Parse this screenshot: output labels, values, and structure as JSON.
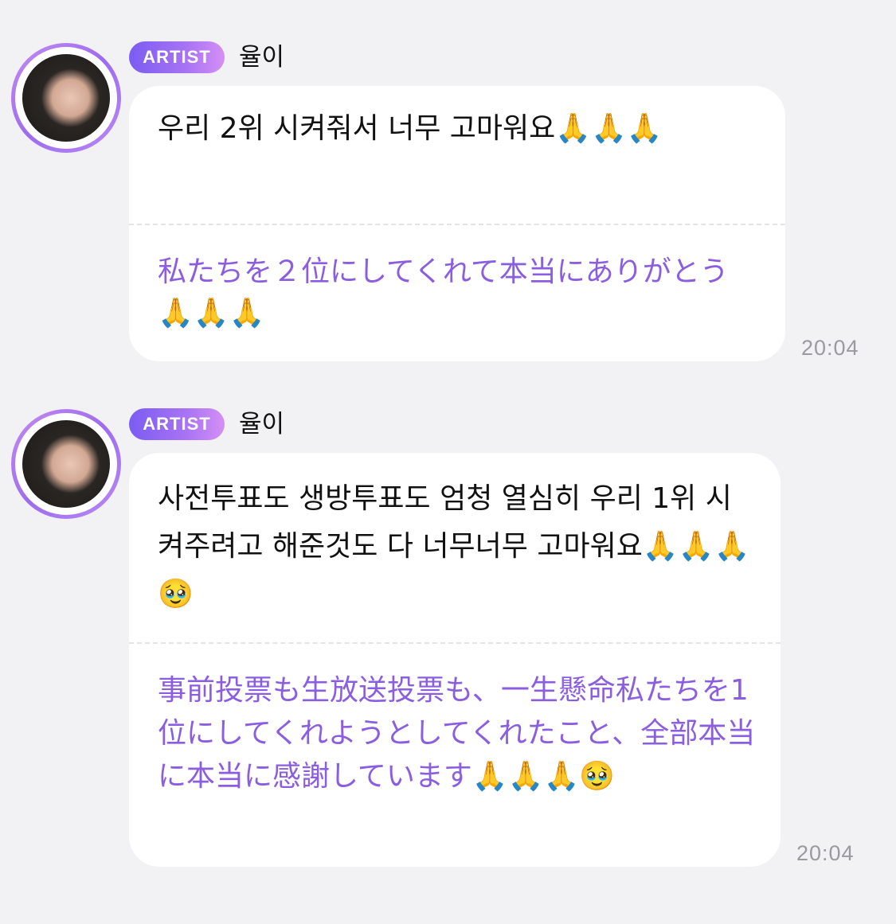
{
  "messages": [
    {
      "badge": "ARTIST",
      "sender": "율이",
      "original": "우리 2위 시켜줘서 너무 고마워요🙏🙏🙏",
      "translation": "私たちを２位にしてくれて本当にありがとう🙏🙏🙏",
      "time": "20:04"
    },
    {
      "badge": "ARTIST",
      "sender": "율이",
      "original": "사전투표도 생방투표도 엄청 열심히 우리 1위 시켜주려고 해준것도 다 너무너무 고마워요🙏🙏🙏🥹",
      "translation": "事前投票も生放送投票も、一生懸命私たちを1位にしてくれようとしてくれたこと、全部本当に本当に感謝しています🙏🙏🙏🥹",
      "time": "20:04"
    }
  ]
}
